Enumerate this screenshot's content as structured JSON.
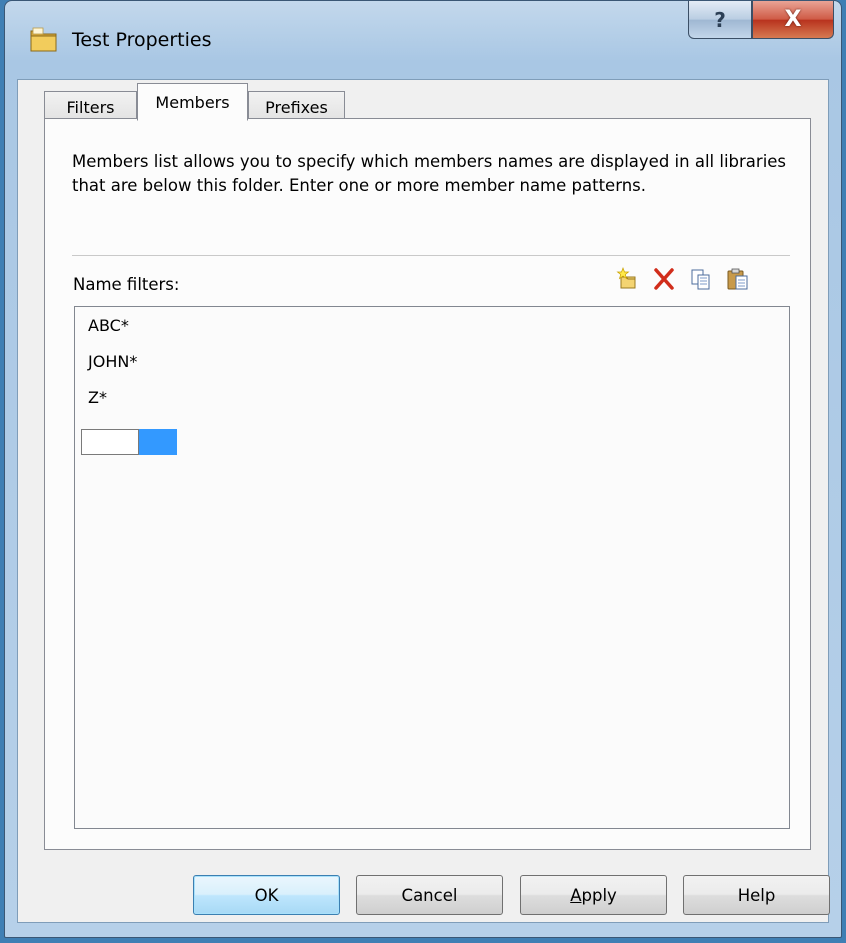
{
  "window": {
    "title": "Test Properties",
    "icon": "folder-icon",
    "help_glyph": "?",
    "close_glyph": "X"
  },
  "tabs": [
    {
      "label": "Filters",
      "selected": false
    },
    {
      "label": "Members",
      "selected": true
    },
    {
      "label": "Prefixes",
      "selected": false
    }
  ],
  "members": {
    "description": "Members list allows you to specify which members names are displayed in all libraries that are below this folder.  Enter one or more member name patterns.",
    "name_filters_label": "Name filters:",
    "toolbar": [
      "new-icon",
      "delete-icon",
      "copy-icon",
      "paste-icon"
    ],
    "filters": [
      "ABC*",
      "JOHN*",
      "Z*"
    ],
    "edit_value": ""
  },
  "buttons": {
    "ok": "OK",
    "cancel": "Cancel",
    "apply_mnemonic": "A",
    "apply_rest": "pply",
    "help": "Help"
  },
  "colors": {
    "selection": "#3399ff",
    "delete_red": "#d12d1b",
    "close_red": "#c8412b"
  }
}
